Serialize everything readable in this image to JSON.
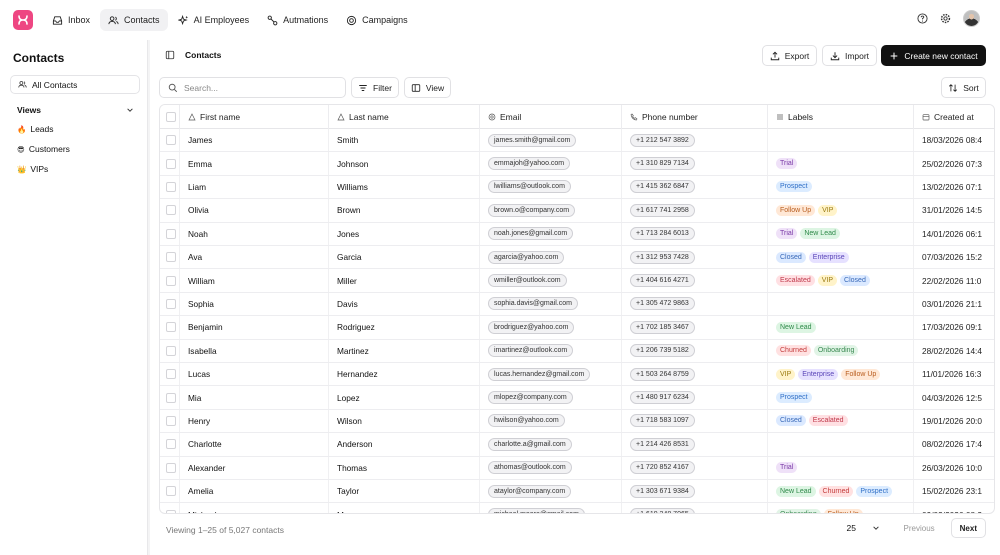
{
  "nav": {
    "items": [
      {
        "label": "Inbox",
        "icon": "inbox-icon",
        "active": false
      },
      {
        "label": "Contacts",
        "icon": "users-icon",
        "active": true
      },
      {
        "label": "AI Employees",
        "icon": "sparkles-icon",
        "active": false
      },
      {
        "label": "Autmations",
        "icon": "automation-icon",
        "active": false
      },
      {
        "label": "Campaigns",
        "icon": "campaign-icon",
        "active": false
      }
    ]
  },
  "sidebar": {
    "title": "Contacts",
    "all_contacts": "All Contacts",
    "views_label": "Views",
    "views": [
      {
        "emoji": "🔥",
        "label": "Leads"
      },
      {
        "emoji": "😎",
        "label": "Customers"
      },
      {
        "emoji": "👑",
        "label": "VIPs"
      }
    ]
  },
  "main": {
    "title": "Contacts",
    "export": "Export",
    "import": "Import",
    "create": "Create new contact",
    "search_placeholder": "Search...",
    "filter": "Filter",
    "view": "View",
    "sort": "Sort"
  },
  "table": {
    "headers": [
      "First name",
      "Last name",
      "Email",
      "Phone number",
      "Labels",
      "Created at"
    ],
    "rows": [
      {
        "first": "James",
        "last": "Smith",
        "email": "james.smith@gmail.com",
        "phone": "+1 212 547 3892",
        "labels": [],
        "created": "18/03/2026 08:4"
      },
      {
        "first": "Emma",
        "last": "Johnson",
        "email": "emmajoh@yahoo.com",
        "phone": "+1 310 829 7134",
        "labels": [
          "Trial"
        ],
        "created": "25/02/2026 07:3"
      },
      {
        "first": "Liam",
        "last": "Williams",
        "email": "lwilliams@outlook.com",
        "phone": "+1 415 362 6847",
        "labels": [
          "Prospect"
        ],
        "created": "13/02/2026 07:1"
      },
      {
        "first": "Olivia",
        "last": "Brown",
        "email": "brown.o@company.com",
        "phone": "+1 617 741 2958",
        "labels": [
          "Follow Up",
          "VIP"
        ],
        "created": "31/01/2026 14:5"
      },
      {
        "first": "Noah",
        "last": "Jones",
        "email": "noah.jones@gmail.com",
        "phone": "+1 713 284 6013",
        "labels": [
          "Trial",
          "New Lead"
        ],
        "created": "14/01/2026 06:1"
      },
      {
        "first": "Ava",
        "last": "Garcia",
        "email": "agarcia@yahoo.com",
        "phone": "+1 312 953 7428",
        "labels": [
          "Closed",
          "Enterprise"
        ],
        "created": "07/03/2026 15:2"
      },
      {
        "first": "William",
        "last": "Miller",
        "email": "wmiller@outlook.com",
        "phone": "+1 404 616 4271",
        "labels": [
          "Escalated",
          "VIP",
          "Closed"
        ],
        "created": "22/02/2026 11:0"
      },
      {
        "first": "Sophia",
        "last": "Davis",
        "email": "sophia.davis@gmail.com",
        "phone": "+1 305 472 9863",
        "labels": [],
        "created": "03/01/2026 21:1"
      },
      {
        "first": "Benjamin",
        "last": "Rodriguez",
        "email": "brodriguez@yahoo.com",
        "phone": "+1 702 185 3467",
        "labels": [
          "New Lead"
        ],
        "created": "17/03/2026 09:1"
      },
      {
        "first": "Isabella",
        "last": "Martinez",
        "email": "imartinez@outlook.com",
        "phone": "+1 206 739 5182",
        "labels": [
          "Churned",
          "Onboarding"
        ],
        "created": "28/02/2026 14:4"
      },
      {
        "first": "Lucas",
        "last": "Hernandez",
        "email": "lucas.hernandez@gmail.com",
        "phone": "+1 503 264 8759",
        "labels": [
          "VIP",
          "Enterprise",
          "Follow Up"
        ],
        "created": "11/01/2026 16:3"
      },
      {
        "first": "Mia",
        "last": "Lopez",
        "email": "mlopez@company.com",
        "phone": "+1 480 917 6234",
        "labels": [
          "Prospect"
        ],
        "created": "04/03/2026 12:5"
      },
      {
        "first": "Henry",
        "last": "Wilson",
        "email": "hwilson@yahoo.com",
        "phone": "+1 718 583 1097",
        "labels": [
          "Closed",
          "Escalated"
        ],
        "created": "19/01/2026 20:0"
      },
      {
        "first": "Charlotte",
        "last": "Anderson",
        "email": "charlotte.a@gmail.com",
        "phone": "+1 214 426 8531",
        "labels": [],
        "created": "08/02/2026 17:4"
      },
      {
        "first": "Alexander",
        "last": "Thomas",
        "email": "athomas@outlook.com",
        "phone": "+1 720 852 4167",
        "labels": [
          "Trial"
        ],
        "created": "26/03/2026 10:0"
      },
      {
        "first": "Amelia",
        "last": "Taylor",
        "email": "ataylor@company.com",
        "phone": "+1 303 671 9384",
        "labels": [
          "New Lead",
          "Churned",
          "Prospect"
        ],
        "created": "15/02/2026 23:1"
      },
      {
        "first": "Michael",
        "last": "Moore",
        "email": "michael.moore@gmail.com",
        "phone": "+1 619 248 7065",
        "labels": [
          "Onboarding",
          "Follow Up"
        ],
        "created": "09/03/2026 08:2"
      }
    ]
  },
  "label_colors": {
    "Trial": {
      "bg": "#efe1f8",
      "fg": "#7a3aa6"
    },
    "Prospect": {
      "bg": "#dcecff",
      "fg": "#2f6fc7"
    },
    "Follow Up": {
      "bg": "#ffe8d6",
      "fg": "#b85c1e"
    },
    "VIP": {
      "bg": "#fff3c9",
      "fg": "#9a7a10"
    },
    "New Lead": {
      "bg": "#ddf5e3",
      "fg": "#2f8a4a"
    },
    "Closed": {
      "bg": "#dbe9ff",
      "fg": "#3768b8"
    },
    "Enterprise": {
      "bg": "#e6e1ff",
      "fg": "#5a45b8"
    },
    "Escalated": {
      "bg": "#ffe0e3",
      "fg": "#c0394b"
    },
    "Churned": {
      "bg": "#ffe1e1",
      "fg": "#c43b3b"
    },
    "Onboarding": {
      "bg": "#e1f4e6",
      "fg": "#3a8a52"
    }
  },
  "footer": {
    "summary": "Viewing 1–25 of 5,027 contacts",
    "page_size": "25",
    "previous": "Previous",
    "next": "Next"
  }
}
